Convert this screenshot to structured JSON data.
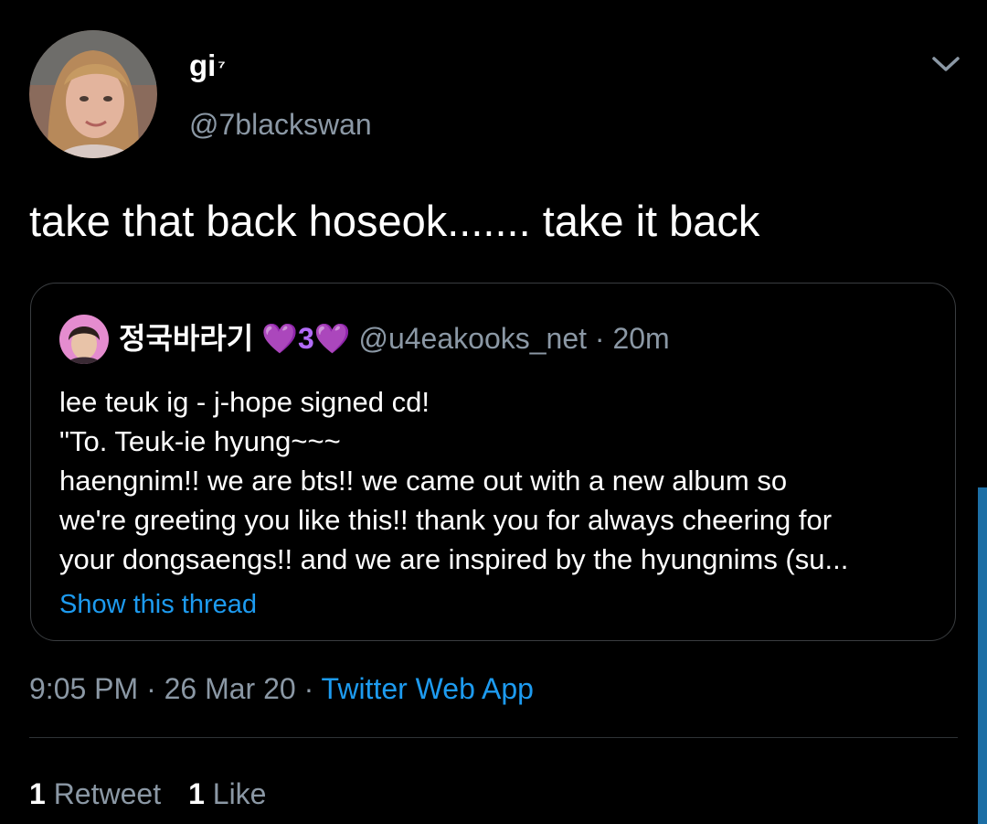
{
  "tweet": {
    "author": {
      "display_name": "gi",
      "name_suffix": "⁷",
      "handle": "@7blackswan",
      "avatar_icon": "profile-photo"
    },
    "menu_icon": "chevron-down-icon",
    "text": "take that back hoseok....... take it back",
    "quoted": {
      "display_name": "정국바라기",
      "name_emoji": "💜3💜",
      "handle": "@u4eakooks_net",
      "time": "· 20m",
      "avatar_icon": "profile-photo",
      "lines": [
        "lee teuk ig - j-hope signed cd!",
        "\"To. Teuk-ie hyung~~~",
        "haengnim!! we are bts!! we came out with a new album so",
        "we're greeting you like this!! thank you for always cheering for",
        "your dongsaengs!! and we are inspired by the hyungnims (su..."
      ],
      "show_thread": "Show this thread"
    },
    "timestamp": "9:05 PM · 26 Mar 20 · ",
    "source": "Twitter Web App",
    "stats": {
      "retweets_count": "1",
      "retweets_label": "Retweet",
      "likes_count": "1",
      "likes_label": "Like"
    }
  },
  "colors": {
    "background": "#000000",
    "text_primary": "#ffffff",
    "text_secondary": "#8b98a5",
    "link": "#1d9bf0",
    "heart": "#b26bf7",
    "border": "#3a3d40"
  }
}
